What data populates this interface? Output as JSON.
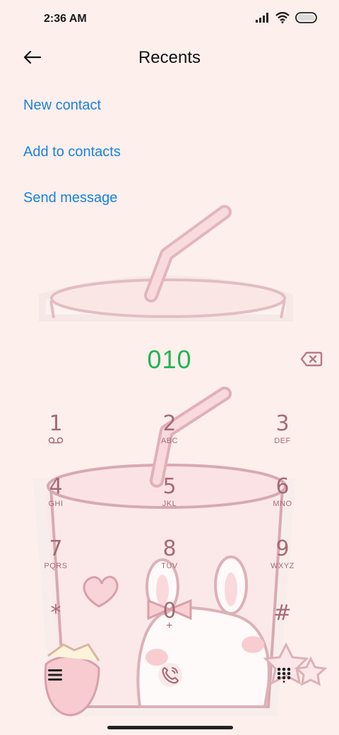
{
  "status_bar": {
    "time": "2:36 AM",
    "icons": [
      "signal-icon",
      "wifi-icon",
      "battery-icon"
    ]
  },
  "header": {
    "title": "Recents",
    "back_icon": "back-arrow-icon"
  },
  "actions": [
    {
      "label": "New contact"
    },
    {
      "label": "Add to contacts"
    },
    {
      "label": "Send message"
    }
  ],
  "dialer": {
    "number": "010",
    "backspace_icon": "backspace-icon"
  },
  "keypad": [
    {
      "digit": "1",
      "letters": "voicemail-icon"
    },
    {
      "digit": "2",
      "letters": "ABC"
    },
    {
      "digit": "3",
      "letters": "DEF"
    },
    {
      "digit": "4",
      "letters": "GHI"
    },
    {
      "digit": "5",
      "letters": "JKL"
    },
    {
      "digit": "6",
      "letters": "MNO"
    },
    {
      "digit": "7",
      "letters": "PQRS"
    },
    {
      "digit": "8",
      "letters": "TUV"
    },
    {
      "digit": "9",
      "letters": "WXYZ"
    },
    {
      "digit": "*",
      "letters": ""
    },
    {
      "digit": "0",
      "letters": "+"
    },
    {
      "digit": "#",
      "letters": ""
    }
  ],
  "bottom_bar": {
    "menu_icon": "menu-icon",
    "call_icon": "call-icon",
    "keypad_icon": "keypad-icon"
  },
  "colors": {
    "accent_blue": "#1a82e2",
    "number_green": "#1fb656",
    "key_color": "#a86a73",
    "background": "#fcefec"
  }
}
